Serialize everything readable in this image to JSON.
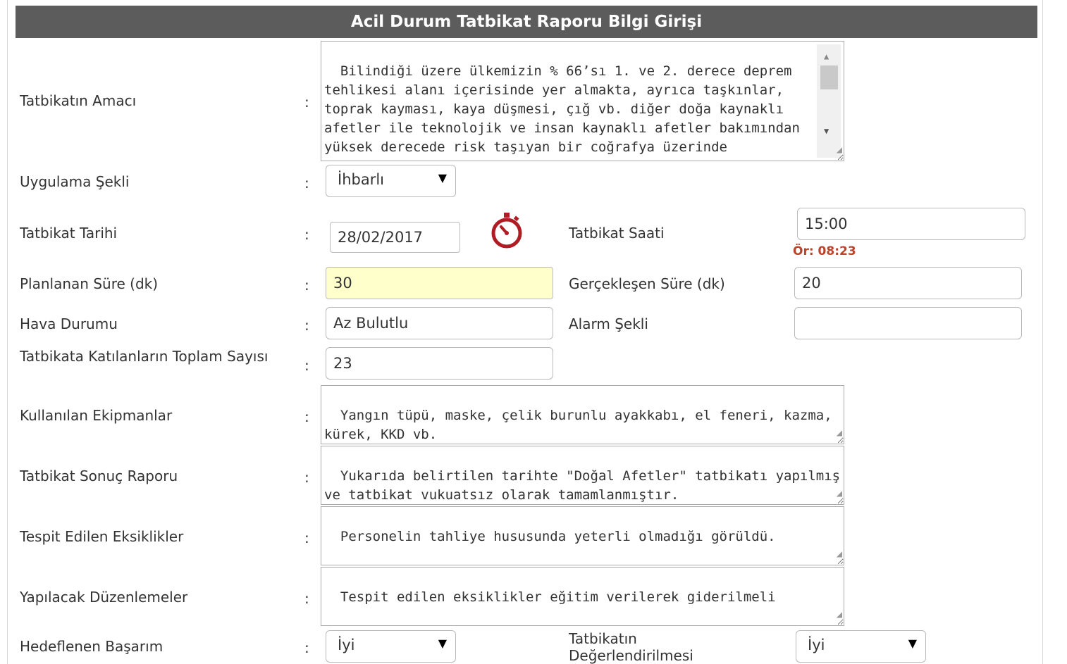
{
  "form": {
    "title": "Acil Durum Tatbikat Raporu Bilgi Girişi",
    "colon": ":",
    "purpose": {
      "label": "Tatbikatın Amacı",
      "text": "Bilindiği üzere ülkemizin % 66’sı 1. ve 2. derece deprem tehlikesi alanı içerisinde yer almakta, ayrıca taşkınlar, toprak kayması, kaya düşmesi, çığ vb. diğer doğa kaynaklı afetler ile teknolojik ve insan kaynaklı afetler bakımından yüksek derecede risk taşıyan bir coğrafya üzerinde bulunmaktadır."
    },
    "application_type": {
      "label": "Uygulama Şekli",
      "value": "İhbarlı"
    },
    "drill_date": {
      "label": "Tatbikat Tarihi",
      "value": "28/02/2017"
    },
    "drill_time": {
      "label": "Tatbikat Saati",
      "value": "15:00",
      "hint": "Ör: 08:23"
    },
    "planned_duration": {
      "label": "Planlanan Süre (dk)",
      "value": "30"
    },
    "actual_duration": {
      "label": "Gerçekleşen Süre (dk)",
      "value": "20"
    },
    "weather": {
      "label": "Hava Durumu",
      "value": "Az Bulutlu"
    },
    "alarm_type": {
      "label": "Alarm Şekli",
      "value": ""
    },
    "participants": {
      "label": "Tatbikata Katılanların Toplam Sayısı",
      "value": "23"
    },
    "equipment": {
      "label": "Kullanılan Ekipmanlar",
      "text": "Yangın tüpü, maske, çelik burunlu ayakkabı, el feneri, kazma, kürek, KKD vb."
    },
    "result_report": {
      "label": "Tatbikat Sonuç Raporu",
      "text": "Yukarıda belirtilen tarihte \"Doğal Afetler\" tatbikatı yapılmış ve tatbikat vukuatsız olarak tamamlanmıştır."
    },
    "deficiencies": {
      "label": "Tespit Edilen Eksiklikler",
      "text": "Personelin tahliye hususunda yeterli olmadığı görüldü."
    },
    "corrections": {
      "label": "Yapılacak Düzenlemeler",
      "text": "Tespit edilen eksiklikler eğitim verilerek giderilmeli"
    },
    "target_success": {
      "label": "Hedeflenen Başarım",
      "value": "İyi"
    },
    "evaluation": {
      "label": "Tatbikatın Değerlendirilmesi",
      "value": "İyi"
    }
  },
  "colors": {
    "header_bg": "#5c5c5c",
    "highlight_input": "#ffffcc",
    "hint_text": "#b8442a",
    "clock_icon": "#b01c24"
  }
}
